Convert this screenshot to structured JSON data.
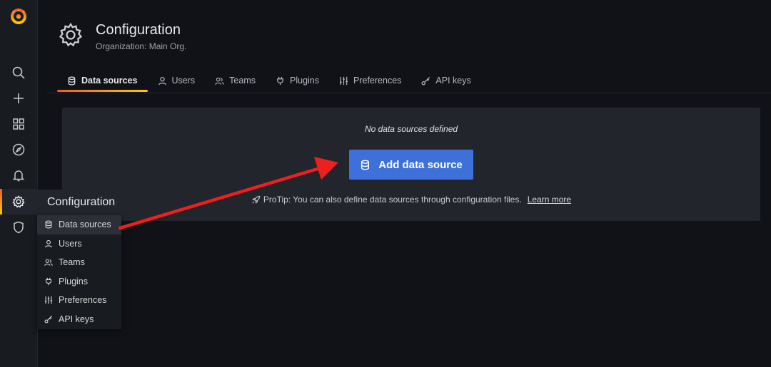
{
  "header": {
    "title": "Configuration",
    "subtitle": "Organization: Main Org."
  },
  "tabs": [
    {
      "label": "Data sources",
      "icon": "database-icon",
      "active": true
    },
    {
      "label": "Users",
      "icon": "user-icon"
    },
    {
      "label": "Teams",
      "icon": "users-icon"
    },
    {
      "label": "Plugins",
      "icon": "plug-icon"
    },
    {
      "label": "Preferences",
      "icon": "sliders-icon"
    },
    {
      "label": "API keys",
      "icon": "key-icon"
    }
  ],
  "sidebar": {
    "items": [
      {
        "icon": "search-icon"
      },
      {
        "icon": "plus-icon"
      },
      {
        "icon": "dashboards-icon"
      },
      {
        "icon": "compass-icon"
      },
      {
        "icon": "bell-icon"
      },
      {
        "icon": "gear-icon",
        "active": true
      },
      {
        "icon": "shield-icon"
      }
    ]
  },
  "main": {
    "empty_text": "No data sources defined",
    "add_button": "Add data source",
    "protip_text": "ProTip: You can also define data sources through configuration files.",
    "protip_link": "Learn more"
  },
  "flyout": {
    "title": "Configuration",
    "items": [
      {
        "label": "Data sources",
        "icon": "database-icon",
        "active": true
      },
      {
        "label": "Users",
        "icon": "user-icon"
      },
      {
        "label": "Teams",
        "icon": "users-icon"
      },
      {
        "label": "Plugins",
        "icon": "plug-icon"
      },
      {
        "label": "Preferences",
        "icon": "sliders-icon"
      },
      {
        "label": "API keys",
        "icon": "key-icon"
      }
    ]
  },
  "colors": {
    "accent": "#f05a28",
    "primary_button": "#3d71d9",
    "annotation_arrow": "#f01f1f"
  }
}
